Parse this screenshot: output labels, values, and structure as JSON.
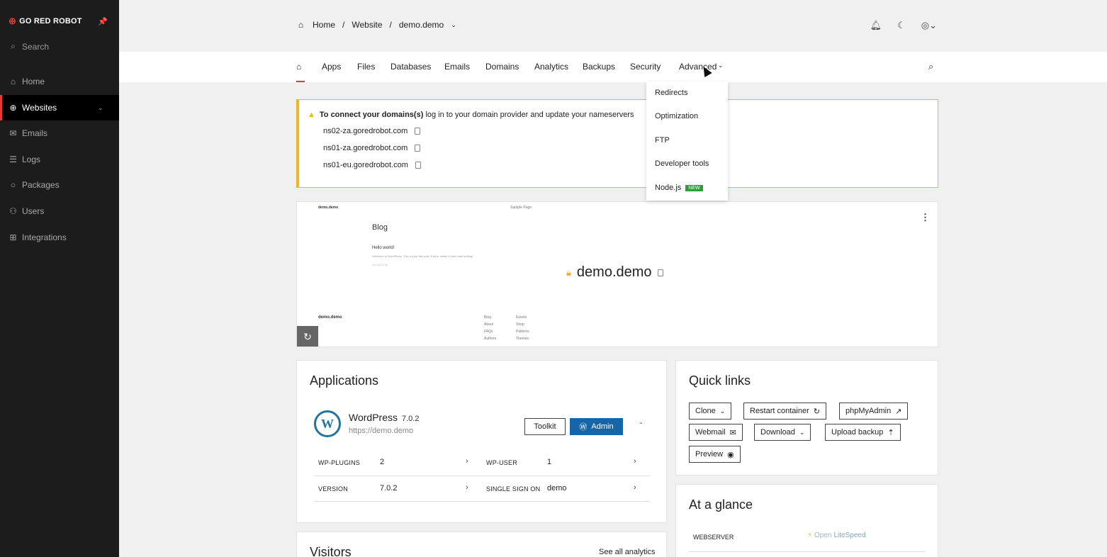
{
  "sidebar": {
    "brand": "GO RED ROBOT",
    "search_label": "Search",
    "items": [
      {
        "label": "Home",
        "icon": "home-icon"
      },
      {
        "label": "Websites",
        "icon": "globe-icon"
      },
      {
        "label": "Emails",
        "icon": "mail-icon"
      },
      {
        "label": "Logs",
        "icon": "log-icon"
      },
      {
        "label": "Packages",
        "icon": "package-icon"
      },
      {
        "label": "Users",
        "icon": "users-icon"
      },
      {
        "label": "Integrations",
        "icon": "grid-icon"
      }
    ]
  },
  "breadcrumb": {
    "home": "Home",
    "sep": "/",
    "website": "Website",
    "current": "demo.demo"
  },
  "tabs": [
    "Apps",
    "Files",
    "Databases",
    "Emails",
    "Domains",
    "Analytics",
    "Backups",
    "Security",
    "Advanced"
  ],
  "dropdown": {
    "items": [
      "Redirects",
      "Optimization",
      "FTP",
      "Developer tools",
      "Node.js"
    ],
    "badge": "NEW"
  },
  "alert": {
    "title_bold": "To connect your domains(s)",
    "title_rest": "log in to your domain provider and update your nameservers",
    "nameservers": [
      "ns02-za.goredrobot.com",
      "ns01-za.goredrobot.com",
      "ns01-eu.goredrobot.com"
    ]
  },
  "preview": {
    "site_brand": "demo.demo",
    "sample_page": "Sample Page",
    "blog": "Blog",
    "hello": "Hello world!",
    "welcome": "Welcome to WordPress. This is your first post. Edit or delete it, then start writing!",
    "date": "Jun 18 2026",
    "footer_brand": "demo.demo",
    "footer_col1": [
      "Blog",
      "About",
      "FAQs",
      "Authors"
    ],
    "footer_col2": [
      "Events",
      "Shop",
      "Patterns",
      "Themes"
    ],
    "domain": "demo.demo"
  },
  "applications": {
    "title": "Applications",
    "app_name": "WordPress",
    "app_version": "7.0.2",
    "app_url": "https://demo.demo",
    "toolkit_label": "Toolkit",
    "admin_label": "Admin",
    "rows": [
      {
        "k1": "WP-PLUGINS",
        "v1": "2",
        "k2": "WP-USER",
        "v2": "1"
      },
      {
        "k1": "VERSION",
        "v1": "7.0.2",
        "k2": "SINGLE SIGN ON",
        "v2": "demo"
      }
    ]
  },
  "visitors": {
    "title": "Visitors",
    "see_all": "See all analytics"
  },
  "quick_links": {
    "title": "Quick links",
    "buttons": [
      "Clone",
      "Restart container",
      "phpMyAdmin",
      "Webmail",
      "Download",
      "Upload backup",
      "Preview"
    ]
  },
  "glance": {
    "title": "At a glance",
    "webserver_label": "WEBSERVER",
    "webserver_value_a": "Open",
    "webserver_value_b": "LiteSpeed"
  },
  "colors": {
    "accent": "#e53935",
    "primary": "#1565a8",
    "warning": "#f0b429",
    "new_badge": "#2e9d3a"
  }
}
